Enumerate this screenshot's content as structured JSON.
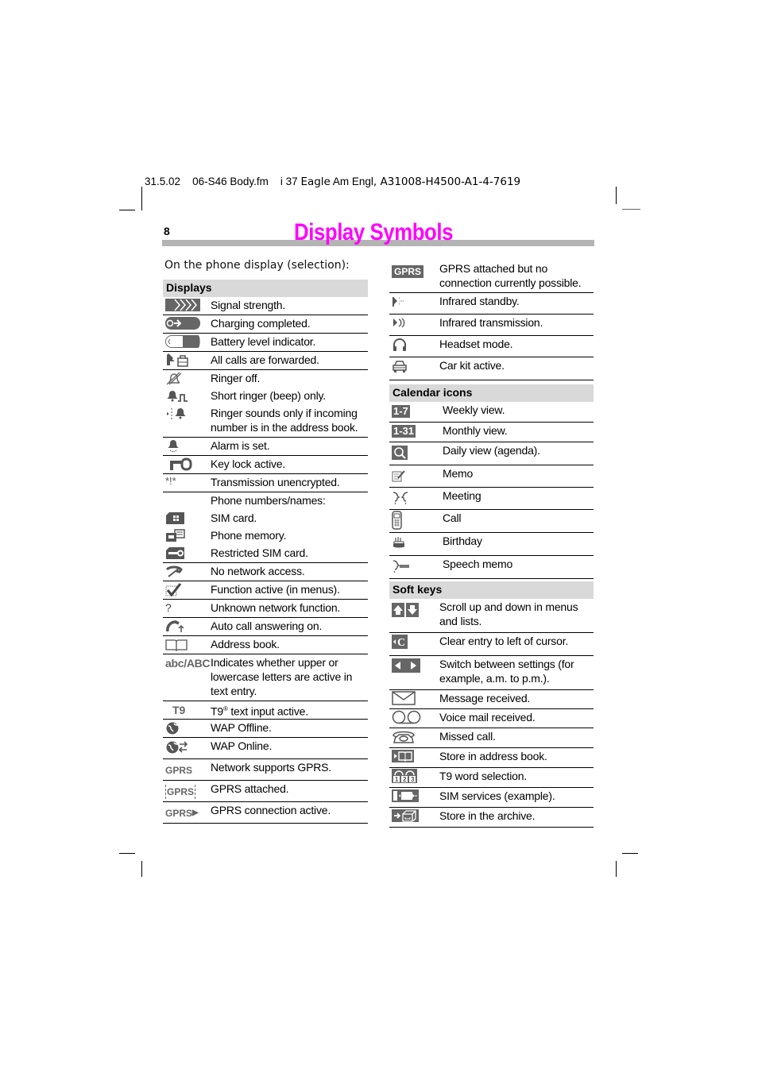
{
  "header": {
    "date": "31.5.02",
    "file": "06-S46 Body.fm",
    "page_ref": "i 37",
    "product": "Eagle",
    "edition": "Am Engl",
    "doc_code": ", A31008-H4500-A1-4-7619"
  },
  "page_number": "8",
  "title": "Display Symbols",
  "colors": {
    "title": "#ff00ff",
    "title_bar": "#b4b4b4",
    "section_band": "#d9d9d9",
    "icon_gray": "#666666"
  },
  "intro": "On the phone display (selection):",
  "left": {
    "section": "Displays",
    "rows": [
      {
        "icon": "signal-strength-icon",
        "text": "Signal strength."
      },
      {
        "icon": "charging-completed-icon",
        "text": "Charging completed."
      },
      {
        "icon": "battery-level-icon",
        "text": "Battery level indicator."
      },
      {
        "icon": "calls-forwarded-icon",
        "text": "All calls are forwarded."
      },
      {
        "icon": "ringer-off-icon",
        "text": "Ringer off."
      },
      {
        "icon": "short-ringer-icon",
        "text": "Short ringer (beep) only."
      },
      {
        "icon": "ringer-addressbook-icon",
        "text": "Ringer sounds only if incoming number is in the address book."
      },
      {
        "icon": "alarm-icon",
        "text": "Alarm is set."
      },
      {
        "icon": "key-lock-icon",
        "text": "Key lock active."
      },
      {
        "icon": "unencrypted-icon",
        "icon_text": "*!*",
        "text": "Transmission unencrypted."
      },
      {
        "icon": "",
        "text": "Phone numbers/names:"
      },
      {
        "icon": "sim-card-icon",
        "text": "SIM card."
      },
      {
        "icon": "phone-memory-icon",
        "text": "Phone memory."
      },
      {
        "icon": "restricted-sim-icon",
        "text": "Restricted SIM card."
      },
      {
        "icon": "no-network-icon",
        "text": "No network access."
      },
      {
        "icon": "function-active-icon",
        "text": "Function active (in menus)."
      },
      {
        "icon": "unknown-function-icon",
        "icon_text": "?",
        "text": "Unknown network function."
      },
      {
        "icon": "auto-answer-icon",
        "text": "Auto call answering on."
      },
      {
        "icon": "address-book-icon",
        "text": "Address book."
      },
      {
        "icon": "case-icon",
        "icon_text": "abc/ABC",
        "text": "Indicates whether upper or lowercase letters are active in text entry."
      },
      {
        "icon": "t9-icon",
        "icon_text": "T9",
        "text": "T9",
        "text_sup": "®",
        "text_rest": " text input active."
      },
      {
        "icon": "wap-offline-icon",
        "text": "WAP Offline."
      },
      {
        "icon": "wap-online-icon",
        "text": "WAP Online."
      },
      {
        "icon": "gprs-supported-icon",
        "icon_text": "GPRS",
        "text": "Network supports GPRS."
      },
      {
        "icon": "gprs-attached-icon",
        "icon_text": "GPRS",
        "text": "GPRS attached."
      },
      {
        "icon": "gprs-active-icon",
        "icon_text": "GPRS",
        "text": "GPRS connection active."
      }
    ]
  },
  "right": {
    "top_rows": [
      {
        "icon": "gprs-no-connection-icon",
        "icon_text": "GPRS",
        "text": "GPRS attached but no connection currently possible."
      },
      {
        "icon": "infrared-standby-icon",
        "text": "Infrared standby."
      },
      {
        "icon": "infrared-transmission-icon",
        "text": "Infrared transmission."
      },
      {
        "icon": "headset-icon",
        "text": "Headset mode."
      },
      {
        "icon": "car-kit-icon",
        "text": "Car kit active."
      }
    ],
    "calendar_section": "Calendar icons",
    "calendar_rows": [
      {
        "icon": "weekly-view-icon",
        "icon_text": "1-7",
        "text": "Weekly view."
      },
      {
        "icon": "monthly-view-icon",
        "icon_text": "1-31",
        "text": "Monthly view."
      },
      {
        "icon": "daily-view-icon",
        "text": "Daily view (agenda)."
      },
      {
        "icon": "memo-icon",
        "text": "Memo"
      },
      {
        "icon": "meeting-icon",
        "text": "Meeting"
      },
      {
        "icon": "call-icon",
        "text": "Call"
      },
      {
        "icon": "birthday-icon",
        "text": "Birthday"
      },
      {
        "icon": "speech-memo-icon",
        "text": "Speech memo"
      }
    ],
    "softkeys_section": "Soft keys",
    "softkey_rows": [
      {
        "icon": "scroll-up-down-icon",
        "text": "Scroll up and down in menus and lists."
      },
      {
        "icon": "clear-entry-icon",
        "text": "Clear entry to left of cursor."
      },
      {
        "icon": "switch-settings-icon",
        "text": "Switch between settings (for example, a.m. to p.m.)."
      },
      {
        "icon": "message-icon",
        "text": "Message received."
      },
      {
        "icon": "voicemail-icon",
        "text": "Voice mail received."
      },
      {
        "icon": "missed-call-icon",
        "text": "Missed call."
      },
      {
        "icon": "store-addressbook-icon",
        "text": "Store in address book."
      },
      {
        "icon": "t9-word-selection-icon",
        "text": "T9 word selection."
      },
      {
        "icon": "sim-services-icon",
        "text": "SIM services (example)."
      },
      {
        "icon": "store-archive-icon",
        "text": "Store in the archive."
      }
    ]
  }
}
